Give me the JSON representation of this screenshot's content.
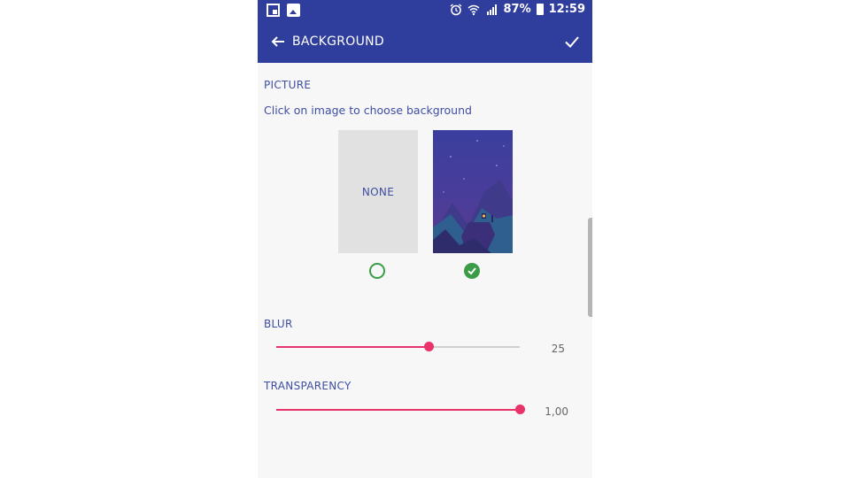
{
  "statusbar": {
    "battery": "87%",
    "time": "12:59"
  },
  "appbar": {
    "title": "BACKGROUND"
  },
  "picture": {
    "label": "PICTURE",
    "hint": "Click on image to choose background",
    "none_label": "NONE",
    "selected": "image"
  },
  "blur": {
    "label": "BLUR",
    "value": "25",
    "fraction": 0.625
  },
  "transparency": {
    "label": "TRANSPARENCY",
    "value": "1,00",
    "fraction": 1.0
  },
  "colors": {
    "primary": "#2f3d9c",
    "accent": "#e8336b",
    "selected_green": "#3a9c47"
  }
}
